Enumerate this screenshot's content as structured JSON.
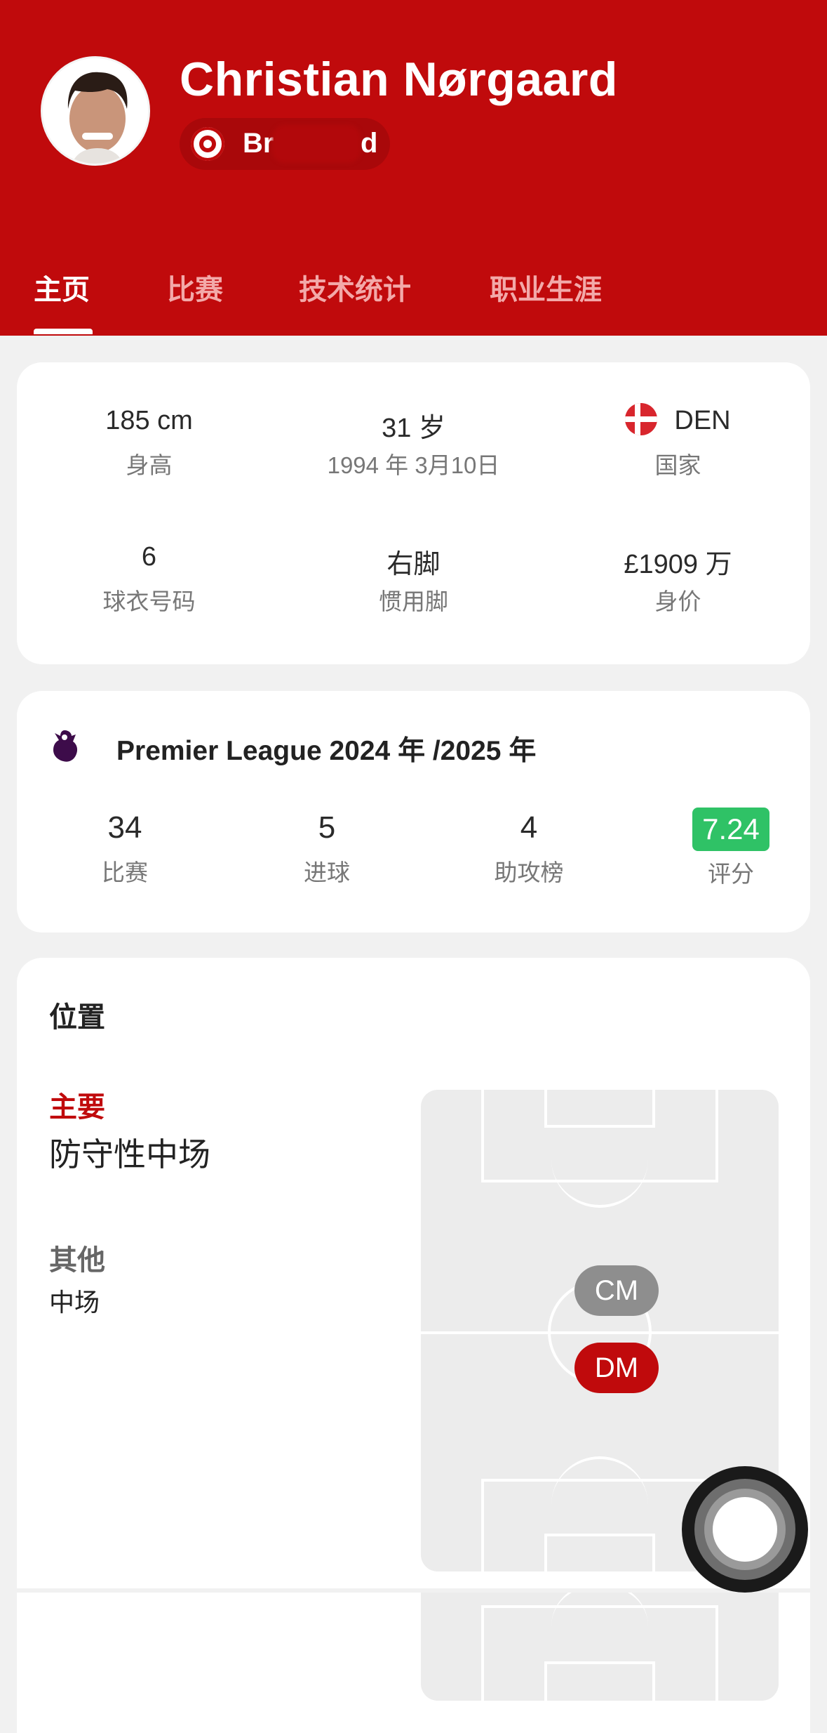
{
  "player": {
    "name": "Christian Nørgaard",
    "team_visible_start": "Br",
    "team_visible_end": "d"
  },
  "tabs": [
    "主页",
    "比赛",
    "技术统计",
    "职业生涯"
  ],
  "info": {
    "height_value": "185 cm",
    "height_label": "身高",
    "age_value": "31 岁",
    "age_label": "1994 年 3月10日",
    "country_value": "DEN",
    "country_label": "国家",
    "shirt_value": "6",
    "shirt_label": "球衣号码",
    "foot_value": "右脚",
    "foot_label": "惯用脚",
    "price_value": "£1909 万",
    "price_label": "身价"
  },
  "season": {
    "title": "Premier League 2024 年 /2025 年",
    "matches_value": "34",
    "matches_label": "比赛",
    "goals_value": "5",
    "goals_label": "进球",
    "assists_value": "4",
    "assists_label": "助攻榜",
    "rating_value": "7.24",
    "rating_label": "评分"
  },
  "position": {
    "title": "位置",
    "primary_label": "主要",
    "primary_value": "防守性中场",
    "other_label": "其他",
    "other_value": "中场",
    "chip_cm": "CM",
    "chip_dm": "DM"
  },
  "colors": {
    "brand_red": "#c00a0c",
    "rating_green": "#2fc266",
    "chip_grey": "#8e8e8e"
  },
  "icons": [
    "player-avatar",
    "team-badge-icon",
    "denmark-flag-icon",
    "premier-league-logo-icon",
    "assistive-touch-icon"
  ]
}
